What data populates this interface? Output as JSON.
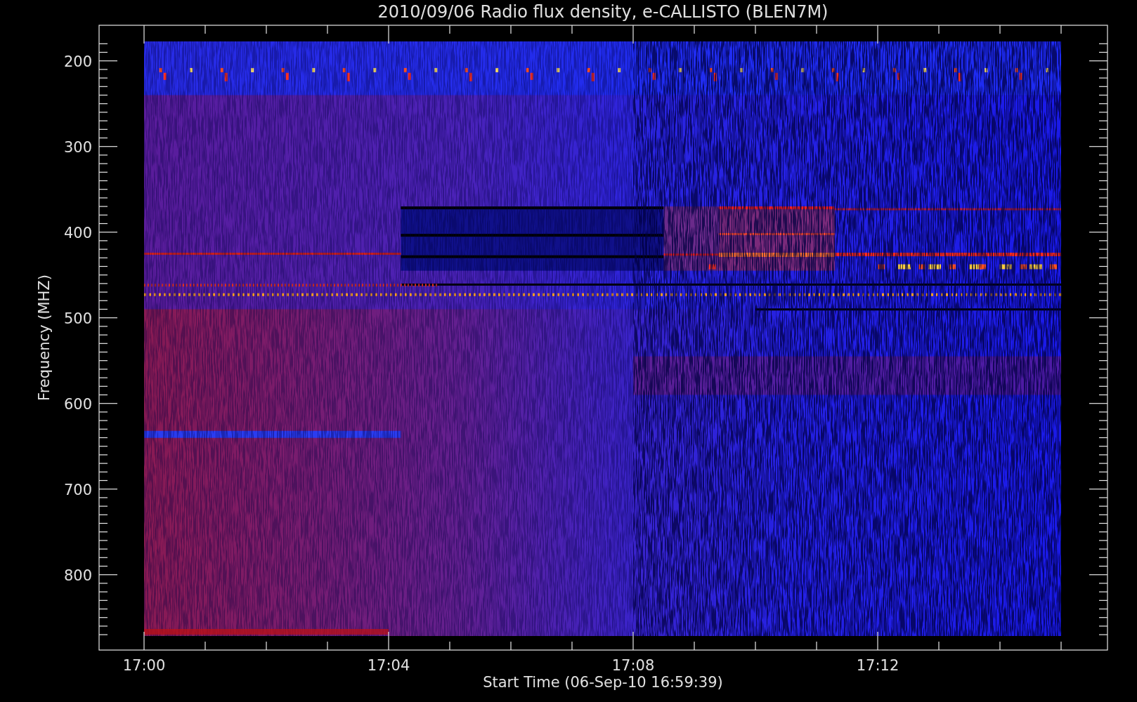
{
  "plot": {
    "title": "2010/09/06  Radio flux density, e-CALLISTO (BLEN7M)",
    "y_axis": {
      "label": "Frequency (MHZ)",
      "ticks": [
        "200",
        "300",
        "400",
        "500",
        "600",
        "700",
        "800"
      ]
    },
    "x_axis": {
      "label": "Start Time (06-Sep-10 16:59:39)",
      "ticks": [
        "17:00",
        "17:04",
        "17:08",
        "17:12"
      ]
    }
  }
}
